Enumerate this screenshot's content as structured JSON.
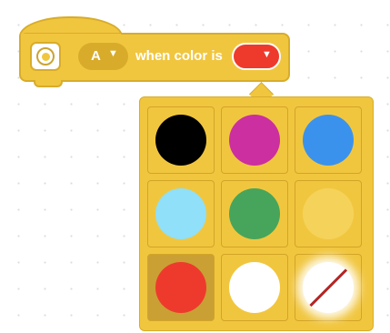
{
  "block": {
    "port_value": "A",
    "caption": "when color is",
    "selected_color": "#ee3a2c",
    "block_color": "#f1c63f"
  },
  "palette": {
    "selected_index": 6,
    "swatches": [
      {
        "name": "black",
        "color": "#000000"
      },
      {
        "name": "magenta",
        "color": "#cc2fa0"
      },
      {
        "name": "blue",
        "color": "#3b92ec"
      },
      {
        "name": "light-blue",
        "color": "#8fe0f8"
      },
      {
        "name": "green",
        "color": "#46a55a"
      },
      {
        "name": "yellow",
        "color": "#f5d35a"
      },
      {
        "name": "red",
        "color": "#ee3a2c"
      },
      {
        "name": "white",
        "color": "#ffffff"
      },
      {
        "name": "no-color",
        "color": "none"
      }
    ]
  }
}
